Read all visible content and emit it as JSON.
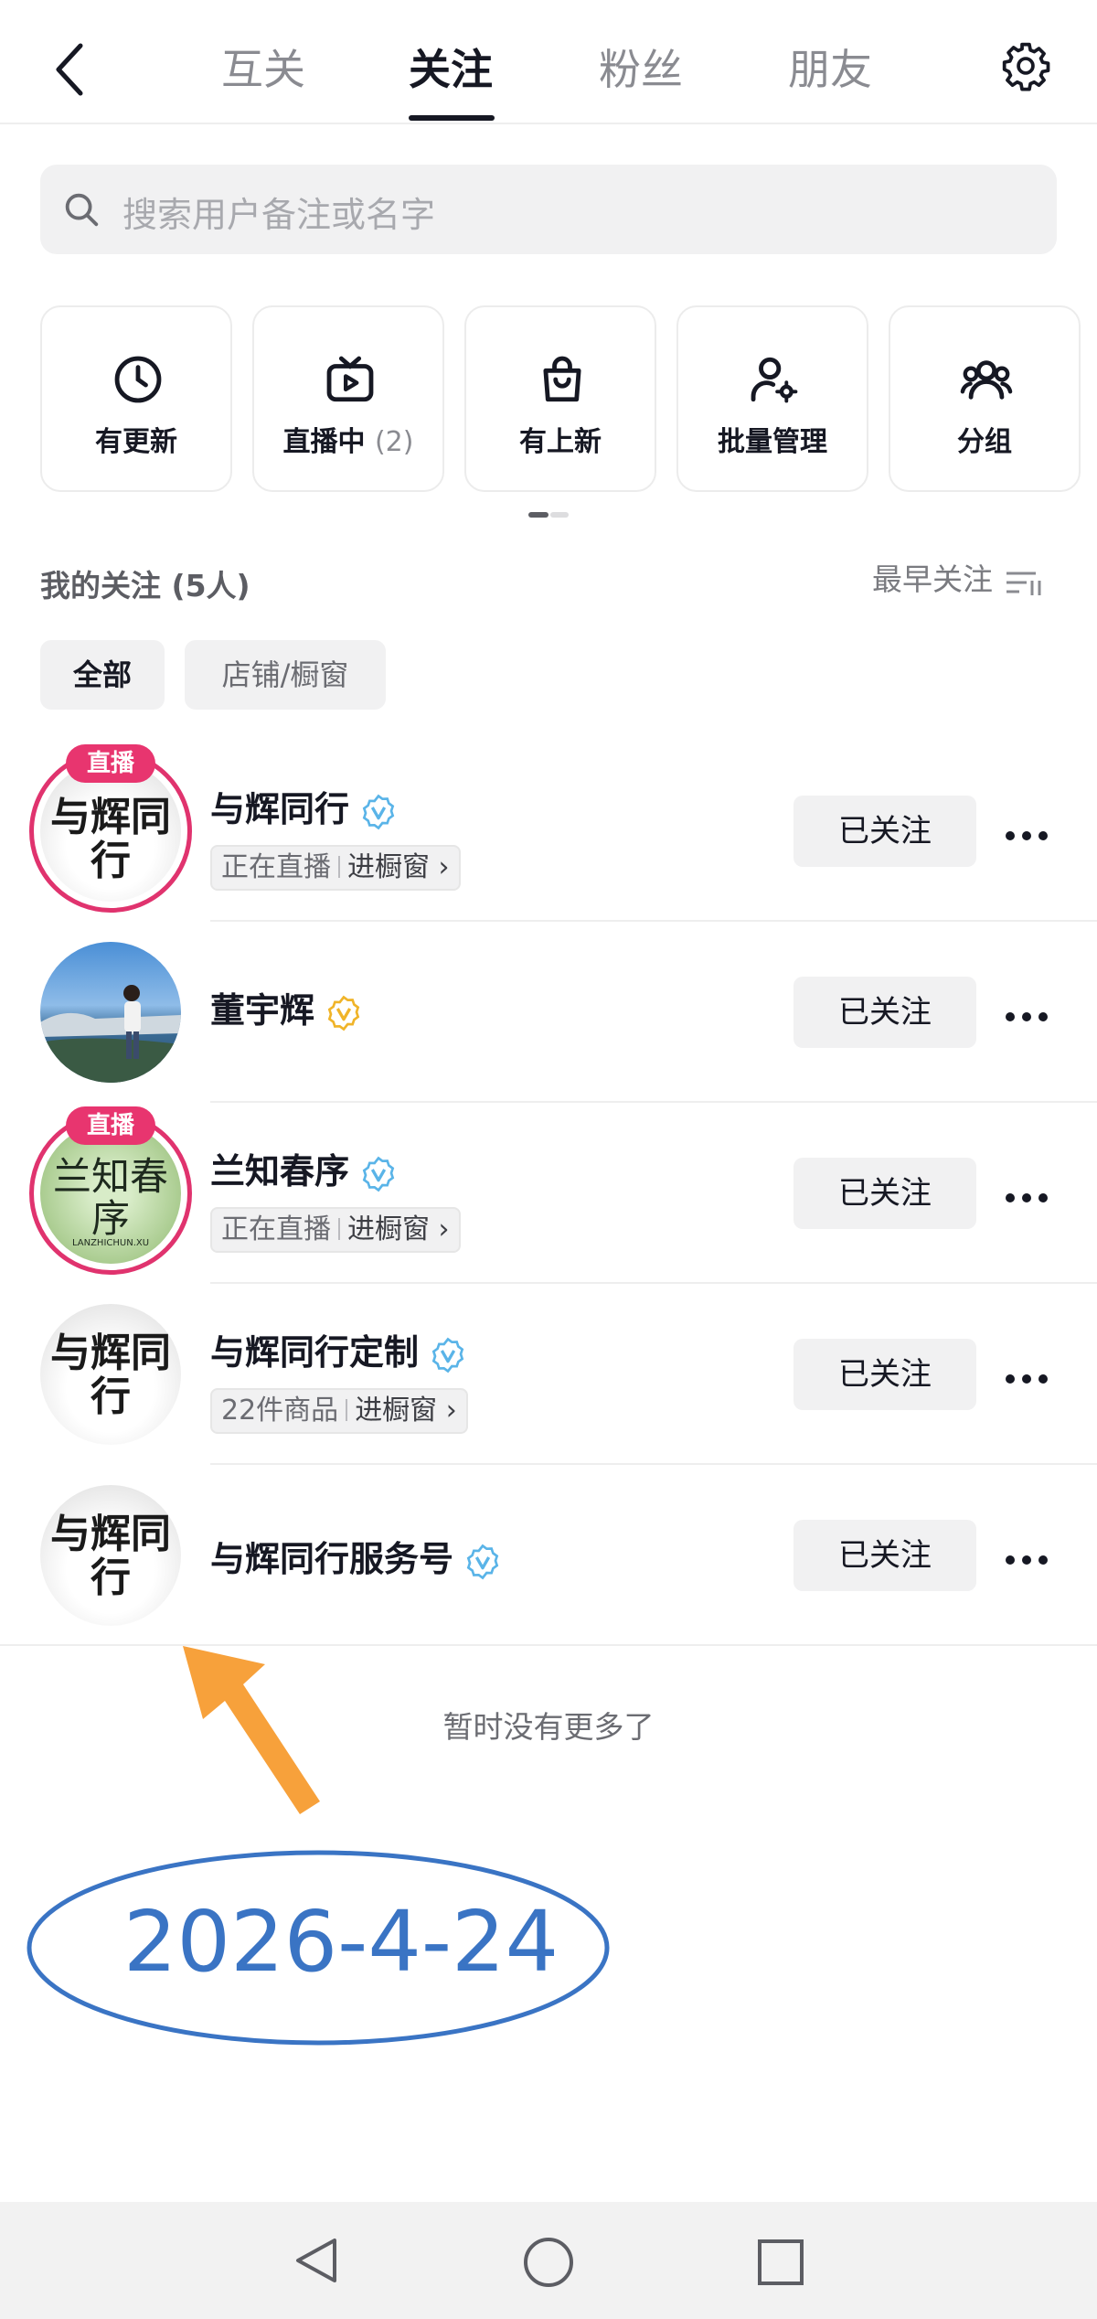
{
  "header": {
    "tabs": [
      {
        "label": "互关",
        "active": false
      },
      {
        "label": "关注",
        "active": true
      },
      {
        "label": "粉丝",
        "active": false
      },
      {
        "label": "朋友",
        "active": false
      }
    ],
    "back_icon": "back-arrow-icon",
    "settings_icon": "gear-icon"
  },
  "search": {
    "placeholder": "搜索用户备注或名字"
  },
  "quick_actions": [
    {
      "label": "有更新",
      "count": "",
      "icon": "clock-icon"
    },
    {
      "label": "直播中",
      "count": "(2)",
      "icon": "tv-live-icon"
    },
    {
      "label": "有上新",
      "count": "",
      "icon": "shopping-bag-icon"
    },
    {
      "label": "批量管理",
      "count": "",
      "icon": "user-gear-icon"
    },
    {
      "label": "分组",
      "count": "",
      "icon": "group-icon"
    }
  ],
  "section": {
    "title": "我的关注 (5人)",
    "sort_label": "最早关注"
  },
  "filters": [
    {
      "label": "全部",
      "active": true
    },
    {
      "label": "店铺/橱窗",
      "active": false
    }
  ],
  "follows": [
    {
      "name": "与辉同行",
      "verified_color": "#5ab4e8",
      "live": true,
      "live_label": "直播",
      "sub_status": "正在直播",
      "sub_link": "进橱窗",
      "button": "已关注",
      "avatar_text": "与辉同行"
    },
    {
      "name": "董宇辉",
      "verified_color": "#f0b429",
      "live": false,
      "sub_status": "",
      "sub_link": "",
      "button": "已关注",
      "avatar_text": ""
    },
    {
      "name": "兰知春序",
      "verified_color": "#5ab4e8",
      "live": true,
      "live_label": "直播",
      "sub_status": "正在直播",
      "sub_link": "进橱窗",
      "button": "已关注",
      "avatar_text": "兰知春序",
      "avatar_caption": "LANZHICHUN.XU"
    },
    {
      "name": "与辉同行定制",
      "verified_color": "#5ab4e8",
      "live": false,
      "sub_status": "22件商品",
      "sub_link": "进橱窗",
      "button": "已关注",
      "avatar_text": "与辉同行"
    },
    {
      "name": "与辉同行服务号",
      "verified_color": "#5ab4e8",
      "live": false,
      "sub_status": "",
      "sub_link": "",
      "button": "已关注",
      "avatar_text": "与辉同行"
    }
  ],
  "footer": {
    "no_more": "暂时没有更多了"
  },
  "annotation": {
    "date": "2026-4-24",
    "arrow_color": "#f7a13b",
    "ellipse_color": "#3a74c4"
  },
  "nav": {
    "icons": [
      "back-triangle-icon",
      "home-circle-icon",
      "recents-square-icon"
    ]
  },
  "colors": {
    "live": "#e0336e",
    "verified_blue": "#5ab4e8",
    "verified_gold": "#f0b429",
    "text": "#161823"
  }
}
